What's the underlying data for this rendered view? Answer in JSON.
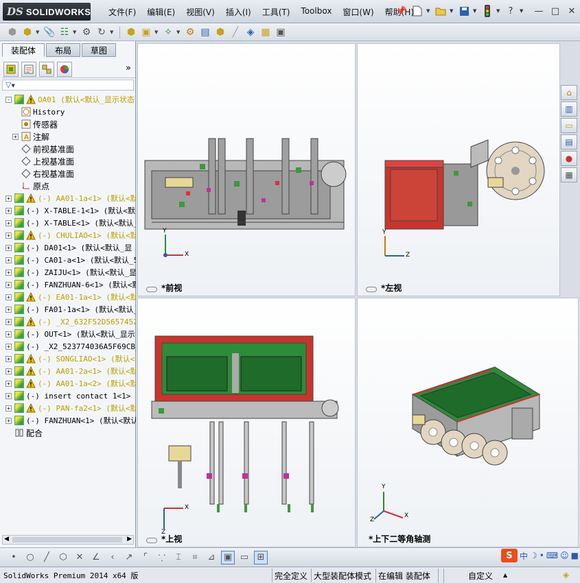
{
  "app": {
    "logo_prefix": "DS",
    "logo_text": "SOLIDWORKS"
  },
  "menu": [
    "文件(F)",
    "编辑(E)",
    "视图(V)",
    "插入(I)",
    "工具(T)",
    "Toolbox",
    "窗口(W)",
    "帮助(H)"
  ],
  "leftpanel": {
    "tabs": [
      "装配体",
      "布局",
      "草图"
    ],
    "active_tab": "装配体",
    "expand_glyph": "»",
    "filter_glyph": "▼"
  },
  "tree": [
    {
      "label": "OA01  (默认<默认_显示状态-",
      "warn": true,
      "yellow": true,
      "expand": "-",
      "icon": "assembly",
      "indent": 0
    },
    {
      "label": "History",
      "icon": "history",
      "indent": 1,
      "expand": ""
    },
    {
      "label": "传感器",
      "icon": "sensor",
      "indent": 1,
      "expand": "",
      "cn": true
    },
    {
      "label": "注解",
      "icon": "annotation",
      "indent": 1,
      "expand": "+",
      "cn": true
    },
    {
      "label": "前视基准面",
      "icon": "plane",
      "indent": 1,
      "expand": "",
      "cn": true
    },
    {
      "label": "上视基准面",
      "icon": "plane",
      "indent": 1,
      "expand": "",
      "cn": true
    },
    {
      "label": "右视基准面",
      "icon": "plane",
      "indent": 1,
      "expand": "",
      "cn": true
    },
    {
      "label": "原点",
      "icon": "origin",
      "indent": 1,
      "expand": "",
      "cn": true
    },
    {
      "label": "(-) AA01-1a<1> (默认<默",
      "warn": true,
      "yellow": true,
      "expand": "+",
      "icon": "assembly",
      "indent": 0
    },
    {
      "label": "(-) X-TABLE-1<1> (默认<默",
      "expand": "+",
      "icon": "assembly",
      "indent": 0
    },
    {
      "label": "(-) X-TABLE<1> (默认<默认_",
      "expand": "+",
      "icon": "assembly",
      "indent": 0
    },
    {
      "label": "(-) CHULIAO<1> (默认<默",
      "warn": true,
      "yellow": true,
      "expand": "+",
      "icon": "assembly",
      "indent": 0
    },
    {
      "label": "(-) DA01<1> (默认<默认_显",
      "expand": "+",
      "icon": "assembly",
      "indent": 0
    },
    {
      "label": "(-) CA01-a<1> (默认<默认_5",
      "expand": "+",
      "icon": "assembly",
      "indent": 0
    },
    {
      "label": "(-) ZAIJU<1> (默认<默认_显",
      "expand": "+",
      "icon": "assembly",
      "indent": 0
    },
    {
      "label": "(-) FANZHUAN-6<1> (默认<默",
      "expand": "+",
      "icon": "assembly",
      "indent": 0
    },
    {
      "label": "(-) EA01-1a<1> (默认<默",
      "warn": true,
      "yellow": true,
      "expand": "+",
      "icon": "assembly",
      "indent": 0
    },
    {
      "label": "(-) FA01-1a<1> (默认<默认_",
      "expand": "+",
      "icon": "assembly",
      "indent": 0
    },
    {
      "label": "(-) _X2_632F52D56574521",
      "warn": true,
      "yellow": true,
      "expand": "+",
      "icon": "assembly",
      "indent": 0
    },
    {
      "label": "(-) OUT<1> (默认<默认_显示",
      "expand": "+",
      "icon": "assembly",
      "indent": 0
    },
    {
      "label": "(-) _X2_523774036A5F69CB_",
      "expand": "+",
      "icon": "assembly",
      "indent": 0
    },
    {
      "label": "(-) SONGLIAO<1> (默认<默",
      "warn": true,
      "yellow": true,
      "expand": "+",
      "icon": "assembly",
      "indent": 0
    },
    {
      "label": "(-) AA01-2a<1> (默认<默",
      "warn": true,
      "yellow": true,
      "expand": "+",
      "icon": "assembly",
      "indent": 0
    },
    {
      "label": "(-) AA01-1a<2> (默认<默",
      "warn": true,
      "yellow": true,
      "expand": "+",
      "icon": "assembly",
      "indent": 0
    },
    {
      "label": "(-) insert contact 1<1> (",
      "expand": "+",
      "icon": "assembly",
      "indent": 0
    },
    {
      "label": "(-) PAN-fa2<1> (默认<默",
      "warn": true,
      "yellow": true,
      "expand": "+",
      "icon": "assembly",
      "indent": 0
    },
    {
      "label": "(-) FANZHUAN<1> (默认<默认",
      "expand": "+",
      "icon": "assembly",
      "indent": 0
    },
    {
      "label": "配合",
      "icon": "mates",
      "indent": 0,
      "expand": "",
      "cn": true
    }
  ],
  "viewports": {
    "front": {
      "label": "*前视",
      "axis_x": "X",
      "axis_y": "Y"
    },
    "left": {
      "label": "*左视",
      "axis_z": "Z",
      "axis_y": "Y"
    },
    "top": {
      "label": "*上视",
      "axis_x": "X",
      "axis_z": "Z"
    },
    "iso": {
      "label": "*上下二等角轴测",
      "axis_x": "X",
      "axis_y": "Y",
      "axis_z": "Z"
    }
  },
  "ime": {
    "logo": "S",
    "lang": "中"
  },
  "statusbar": {
    "product": "SolidWorks Premium 2014 x64 版",
    "status1": "完全定义",
    "status2": "大型装配体模式",
    "status3": "在编辑 装配体",
    "units": "自定义",
    "units_arrow": "▲"
  },
  "colors": {
    "accent_blue": "#1f4ea0",
    "warning_yellow": "#f0c000",
    "frame_red": "#c0302a",
    "panel_green": "#2e8b3a"
  }
}
